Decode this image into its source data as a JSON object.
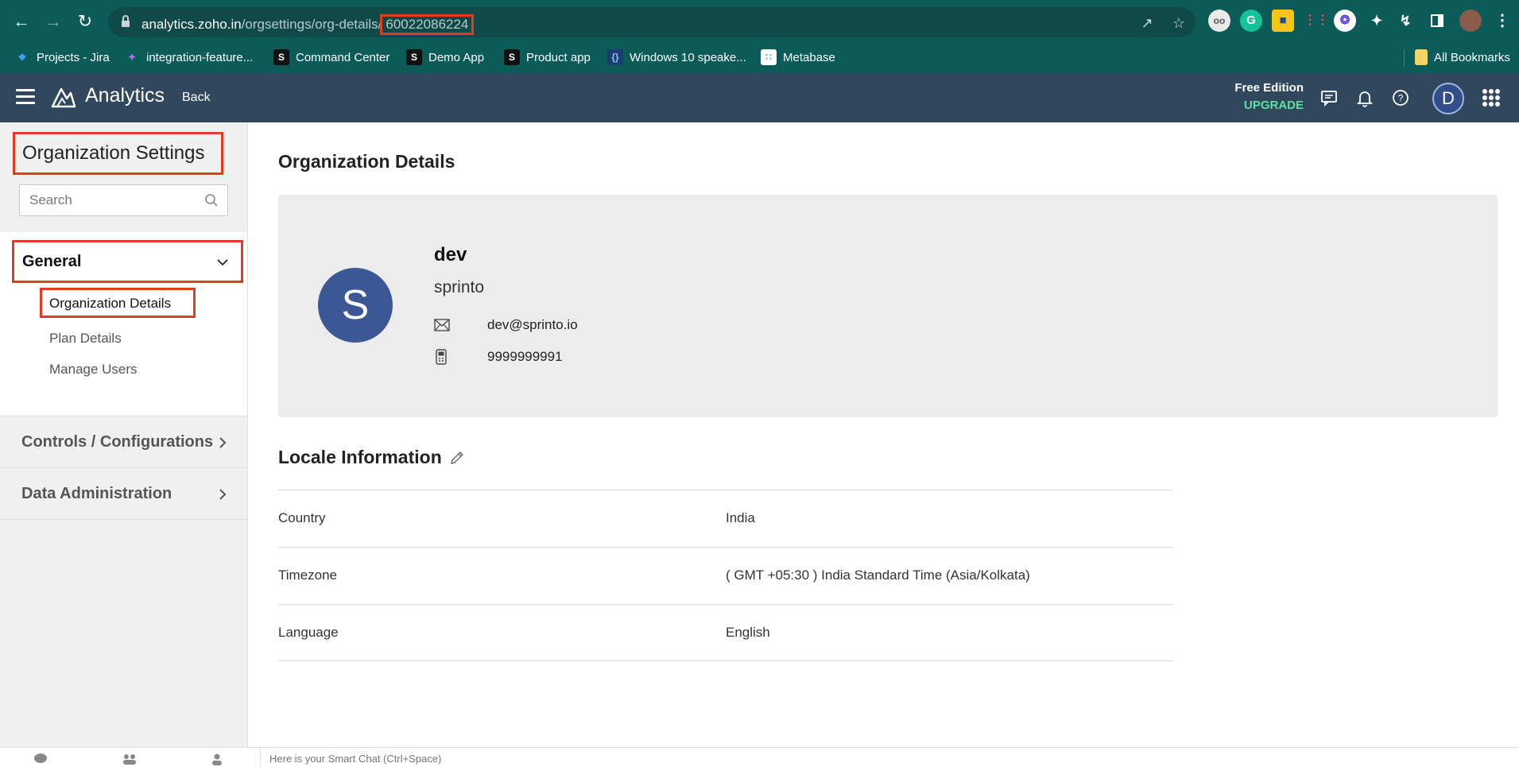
{
  "browser": {
    "url_host": "analytics.zoho.in",
    "url_path": "/orgsettings/org-details/",
    "url_id": "60022086224",
    "bookmarks": [
      {
        "label": "Projects - Jira"
      },
      {
        "label": "integration-feature..."
      },
      {
        "label": "Command Center"
      },
      {
        "label": "Demo App"
      },
      {
        "label": "Product app"
      },
      {
        "label": "Windows 10 speake..."
      },
      {
        "label": "Metabase"
      },
      {
        "label": "All Bookmarks"
      }
    ]
  },
  "header": {
    "app_name": "Analytics",
    "back_label": "Back",
    "edition_label": "Free Edition",
    "upgrade_label": "UPGRADE",
    "avatar_initial": "D"
  },
  "sidebar": {
    "title": "Organization Settings",
    "search_placeholder": "Search",
    "general_label": "General",
    "general_items": [
      {
        "label": "Organization Details"
      },
      {
        "label": "Plan Details"
      },
      {
        "label": "Manage Users"
      }
    ],
    "sections": [
      {
        "label": "Controls / Configurations"
      },
      {
        "label": "Data Administration"
      }
    ]
  },
  "main": {
    "page_title": "Organization Details",
    "org": {
      "avatar_initial": "S",
      "name": "dev",
      "company": "sprinto",
      "email": "dev@sprinto.io",
      "phone": "9999999991"
    },
    "locale_title": "Locale Information",
    "locale_rows": [
      {
        "key": "Country",
        "value": "India"
      },
      {
        "key": "Timezone",
        "value": "( GMT +05:30 ) India Standard Time (Asia/Kolkata)"
      },
      {
        "key": "Language",
        "value": "English"
      }
    ]
  },
  "chat": {
    "placeholder": "Here is your Smart Chat (Ctrl+Space)"
  },
  "colors": {
    "browser_bg": "#0b5c59",
    "app_header": "#30475e",
    "highlight": "#e23b1f",
    "org_avatar": "#3b5795",
    "upgrade": "#5ee0a0"
  }
}
